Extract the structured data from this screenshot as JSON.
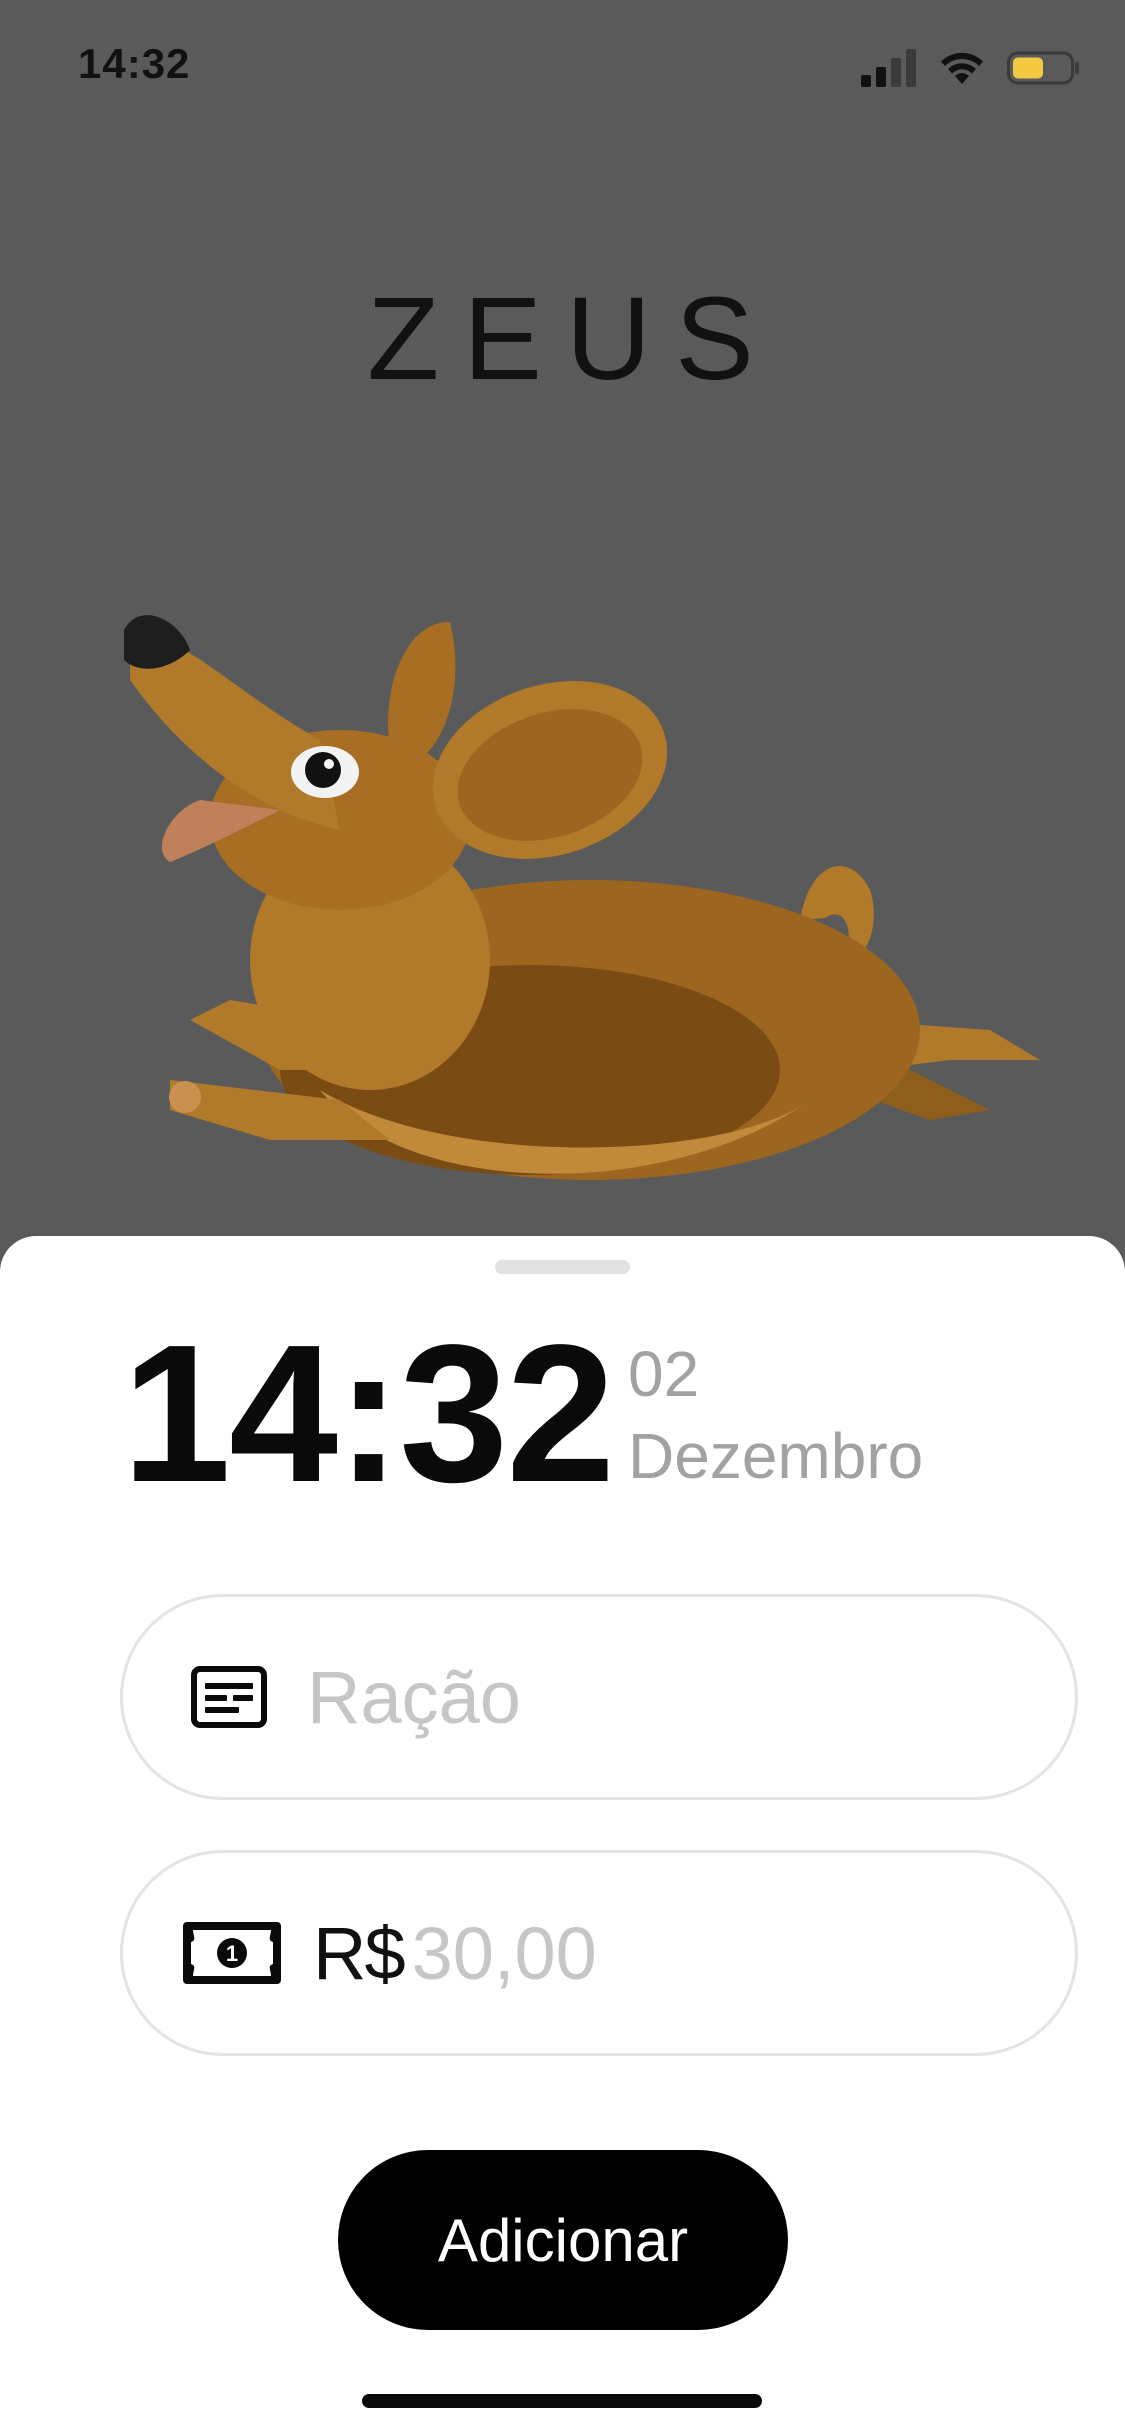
{
  "status_bar": {
    "time": "14:32",
    "battery_color": "#f5c842"
  },
  "header": {
    "title": "ZEUS"
  },
  "illustration": {
    "icon": "dachshund-dog-icon"
  },
  "sheet": {
    "time": "14:32",
    "day": "02",
    "month": "Dezembro",
    "description_field": {
      "icon": "document-card-icon",
      "value": "",
      "placeholder": "Ração"
    },
    "amount_field": {
      "icon": "banknote-icon",
      "currency": "R$",
      "value": "",
      "placeholder": "30,00"
    },
    "add_button_label": "Adicionar"
  },
  "colors": {
    "overlay_background": "#5a5a5a",
    "sheet_background": "#ffffff",
    "primary": "#000000",
    "muted_text": "#a2a2a2",
    "placeholder": "#c6c6c6"
  }
}
